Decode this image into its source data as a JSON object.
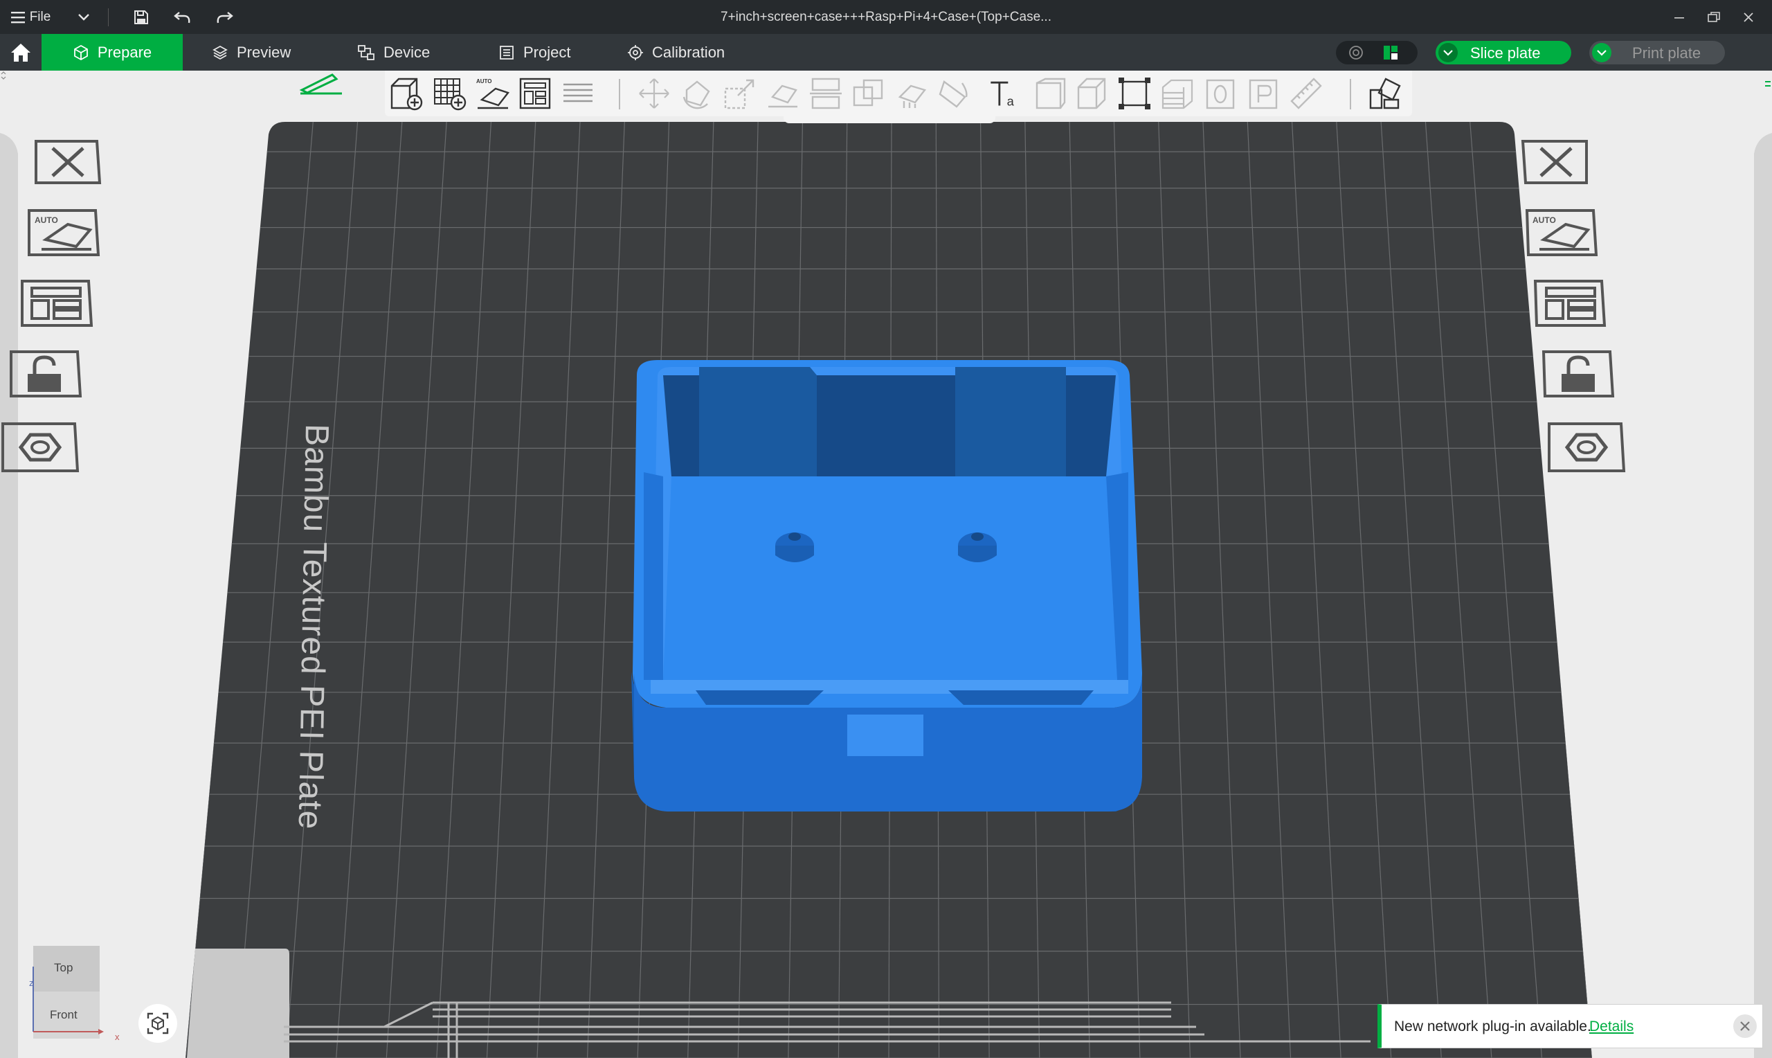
{
  "window": {
    "title": "7+inch+screen+case+++Rasp+Pi+4+Case+(Top+Case...",
    "file_menu_label": "File"
  },
  "tabs": [
    {
      "label": "Prepare",
      "icon": "cube-icon",
      "active": true
    },
    {
      "label": "Preview",
      "icon": "layers-icon",
      "active": false
    },
    {
      "label": "Device",
      "icon": "device-icon",
      "active": false
    },
    {
      "label": "Project",
      "icon": "project-icon",
      "active": false
    },
    {
      "label": "Calibration",
      "icon": "calibration-icon",
      "active": false
    }
  ],
  "actions": {
    "slice_label": "Slice plate",
    "print_label": "Print plate"
  },
  "plate": {
    "label": "Bambu Textured PEI Plate"
  },
  "view_cube": {
    "top_label": "Top",
    "front_label": "Front",
    "axis_z": "z",
    "axis_x": "x"
  },
  "notification": {
    "message": "New network plug-in available.",
    "link_label": "Details"
  },
  "colors": {
    "accent": "#00ae42",
    "model_blue": "#2f8af0",
    "plate_dark": "#3c3e40",
    "titlebar": "#262a2d"
  }
}
